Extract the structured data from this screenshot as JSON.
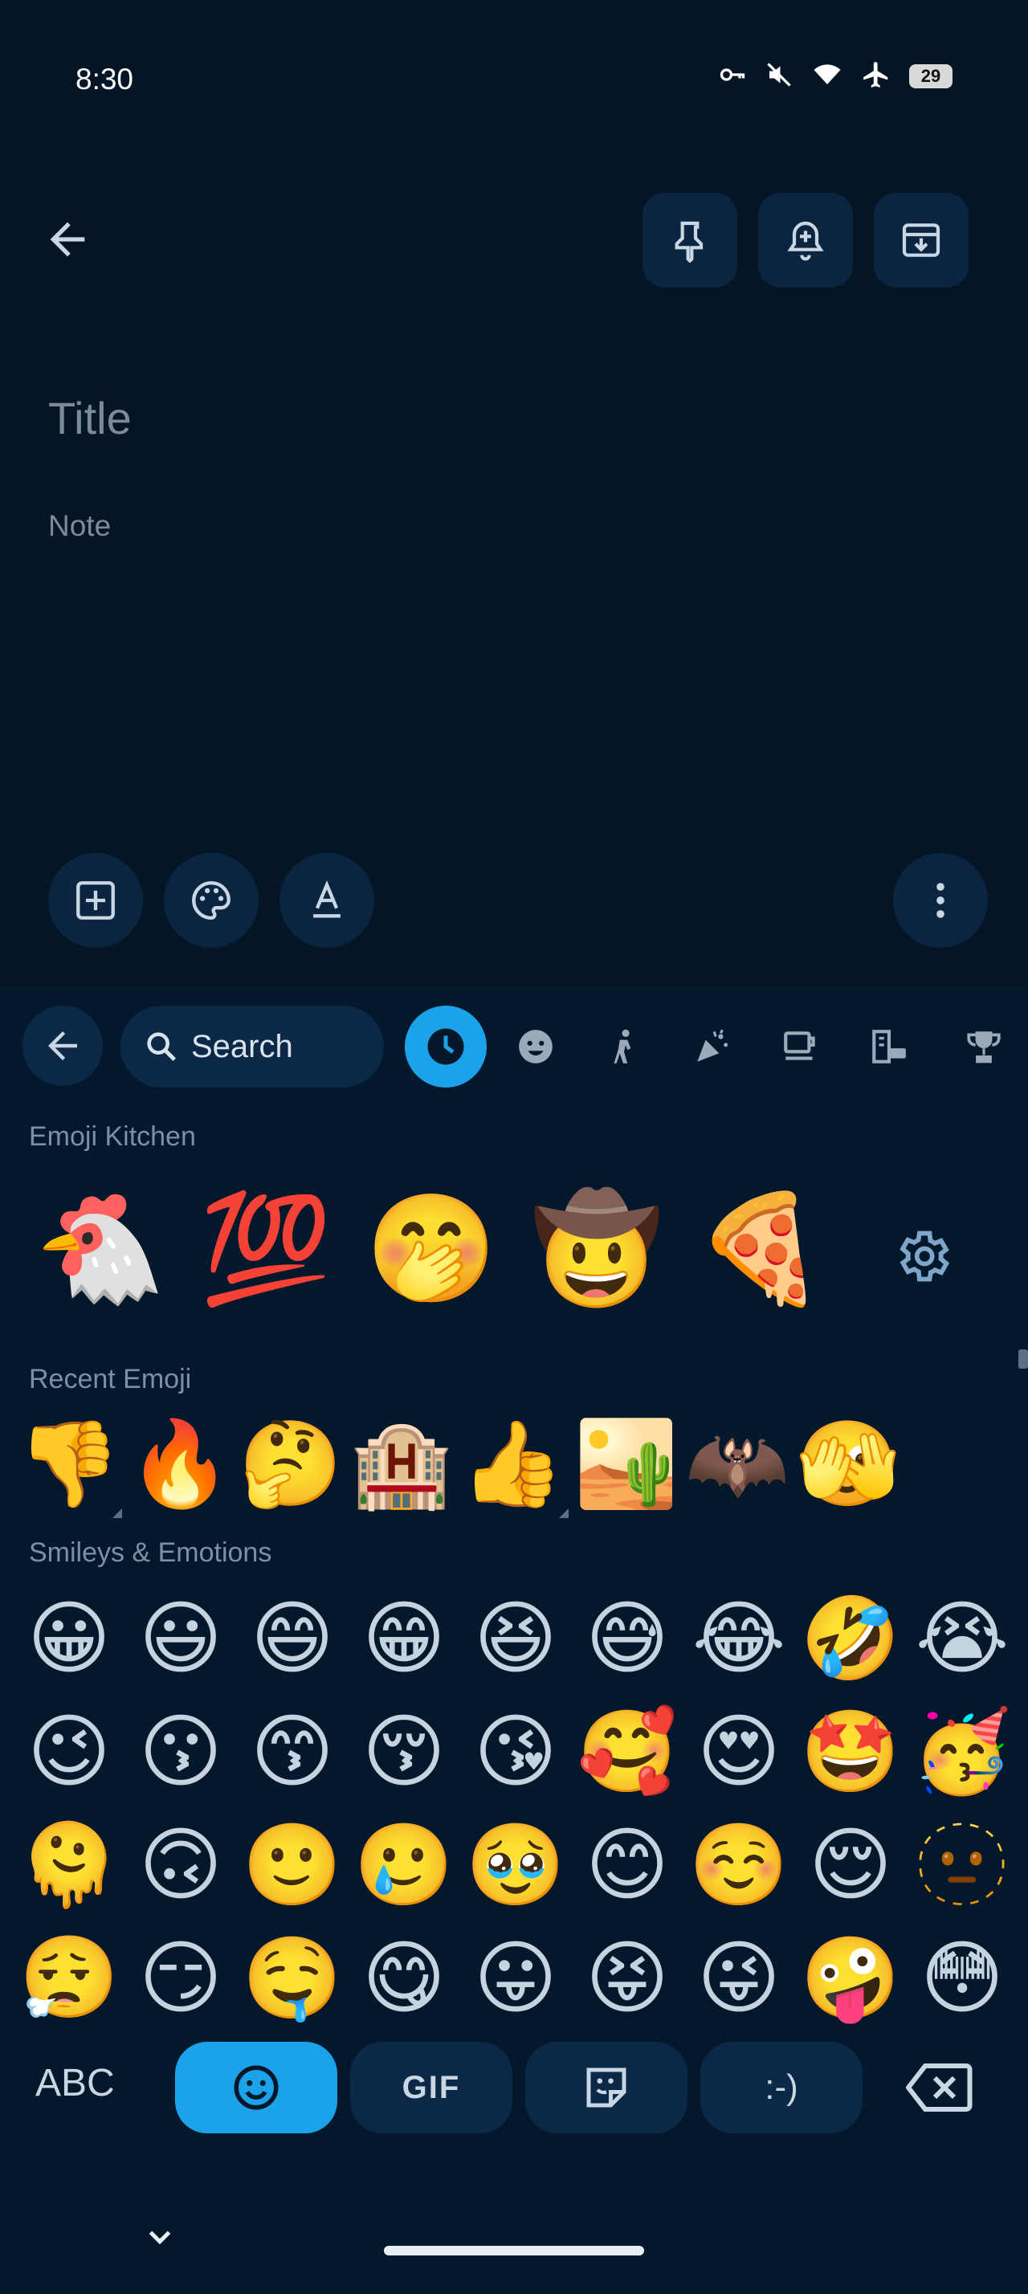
{
  "status_bar": {
    "time": "8:30",
    "battery": "29"
  },
  "note": {
    "title_placeholder": "Title",
    "note_placeholder": "Note"
  },
  "search": {
    "label": "Search"
  },
  "sections": {
    "kitchen": "Emoji Kitchen",
    "recent": "Recent Emoji",
    "smileys": "Smileys & Emotions"
  },
  "kitchen_items": [
    "🐔",
    "💯",
    "🤭",
    "🤠",
    "🍕"
  ],
  "recent_items": [
    "👎",
    "🔥",
    "🤔",
    "🏨",
    "👍",
    "🏜️",
    "🦇",
    "🫣"
  ],
  "smileys": [
    [
      "😀",
      "😃",
      "😄",
      "😁",
      "😆",
      "😅",
      "😂",
      "🤣",
      "😭"
    ],
    [
      "😉",
      "😗",
      "😙",
      "😚",
      "😘",
      "🥰",
      "😍",
      "🤩",
      "🥳"
    ],
    [
      "🫠",
      "🙃",
      "🙂",
      "🥲",
      "🥹",
      "😊",
      "☺️",
      "😌",
      "🫥"
    ],
    [
      "😮‍💨",
      "😏",
      "🤤",
      "😋",
      "😛",
      "😝",
      "😜",
      "🤪",
      "😳"
    ]
  ],
  "bottom_bar": {
    "abc": "ABC",
    "gif": "GIF",
    "emoticon": ":-)"
  },
  "colors": {
    "background": "#041525",
    "accent": "#1aa3e8",
    "button": "#0b2540"
  }
}
